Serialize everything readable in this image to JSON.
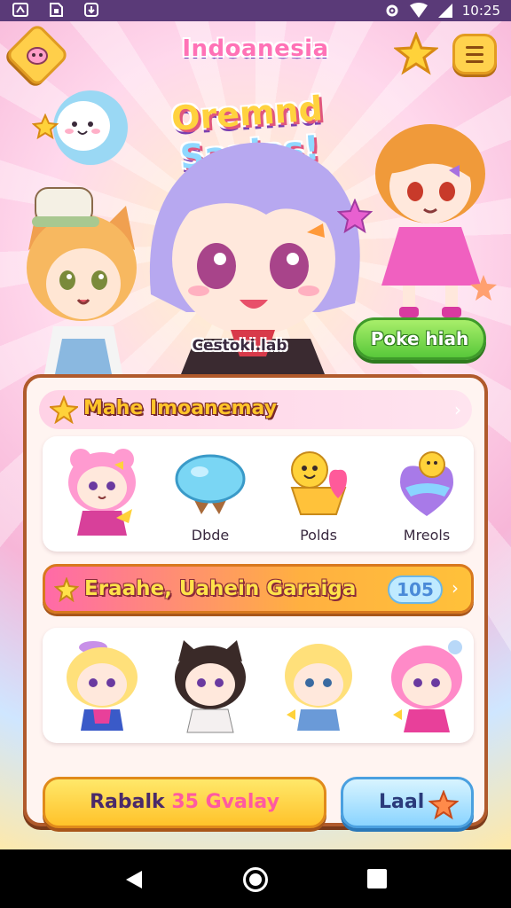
{
  "statusbar": {
    "time": "10:25",
    "left_icons": [
      "notification-icon",
      "sim-icon",
      "download-icon"
    ],
    "right_icons": [
      "settings-icon",
      "wifi-icon",
      "signal-icon"
    ]
  },
  "header": {
    "title": "Indoanesia"
  },
  "logo": {
    "part1": "Oremnd",
    "part2": "Saaias!"
  },
  "hero": {
    "caption": "Cestoki.lab"
  },
  "poke_button": {
    "label": "Poke hiah"
  },
  "section1": {
    "title": "Mahe Imoanemay",
    "items": [
      {
        "icon": "pink-bear-girl-icon",
        "label": ""
      },
      {
        "icon": "blue-cloud-icon",
        "label": "Dbde"
      },
      {
        "icon": "heart-face-icon",
        "label": "Polds"
      },
      {
        "icon": "rainbow-heart-icon",
        "label": "Mreols"
      }
    ]
  },
  "section2": {
    "title": "Eraahe, Uahein Garaiga",
    "count": "105",
    "characters": [
      "blonde-cat-girl-icon",
      "dark-hair-cat-girl-icon",
      "blonde-boy-icon",
      "pink-hair-girl-icon"
    ]
  },
  "buttons": {
    "primary_prefix": "Rabalk",
    "primary_number": "35",
    "primary_suffix": "Gvalay",
    "secondary": "Laal"
  },
  "colors": {
    "accent_pink": "#ff72b6",
    "accent_yellow": "#ffc22a",
    "accent_green": "#58c83a",
    "panel_border": "#b05a2c"
  }
}
